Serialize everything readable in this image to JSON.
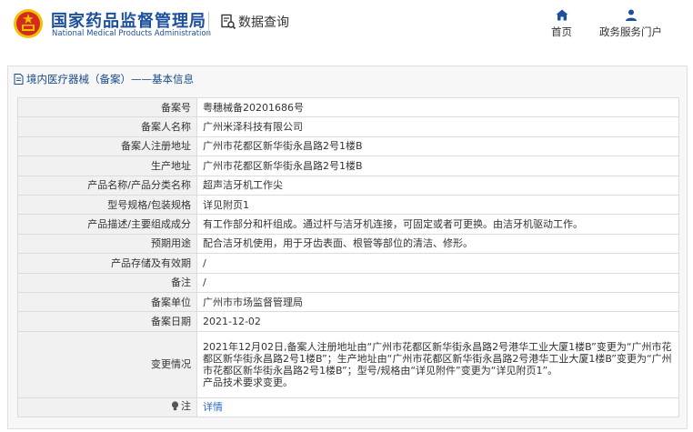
{
  "header": {
    "brand_cn": "国家药品监督管理局",
    "brand_en": "National Medical Products Administration",
    "query_label": "数据查询",
    "nav": [
      {
        "label": "首页",
        "icon": "home-icon"
      },
      {
        "label": "政务服务门户",
        "icon": "user-icon"
      }
    ]
  },
  "panel": {
    "title": "境内医疗器械（备案）——基本信息"
  },
  "records": [
    {
      "label": "备案号",
      "value": "粤穗械备20201686号"
    },
    {
      "label": "备案人名称",
      "value": "广州米泽科技有限公司"
    },
    {
      "label": "备案人注册地址",
      "value": "广州市花都区新华街永昌路2号1楼B"
    },
    {
      "label": "生产地址",
      "value": "广州市花都区新华街永昌路2号1楼B"
    },
    {
      "label": "产品名称/产品分类名称",
      "value": "超声洁牙机工作尖"
    },
    {
      "label": "型号规格/包装规格",
      "value": "详见附页1"
    },
    {
      "label": "产品描述/主要组成成分",
      "value": "有工作部分和杆组成。通过杆与洁牙机连接，可固定或者可更换。由洁牙机驱动工作。"
    },
    {
      "label": "预期用途",
      "value": "配合洁牙机使用，用于牙齿表面、根管等部位的清洁、修形。"
    },
    {
      "label": "产品存储及有效期",
      "value": "/"
    },
    {
      "label": "备注",
      "value": "/"
    },
    {
      "label": "备案单位",
      "value": "广州市市场监督管理局"
    },
    {
      "label": "备案日期",
      "value": "2021-12-02"
    }
  ],
  "change": {
    "label": "变更情况",
    "value": "2021年12月02日,备案人注册地址由“广州市花都区新华街永昌路2号港华工业大厦1楼B”变更为“广州市花都区新华街永昌路2号1楼B”；生产地址由“广州市花都区新华街永昌路2号港华工业大厦1楼B”变更为“广州市花都区新华街永昌路2号1楼B”；型号/规格由“详见附件”变更为“详见附页1”。\n产品技术要求变更。"
  },
  "note": {
    "label": "注",
    "link": "详情",
    "icon": "bulb-icon"
  },
  "colors": {
    "brand_blue": "#1c4f9c",
    "label_bg": "#f1f1f1",
    "link": "#2c6ac9",
    "emblem_red": "#d52b1e",
    "emblem_gold": "#f2c200"
  }
}
